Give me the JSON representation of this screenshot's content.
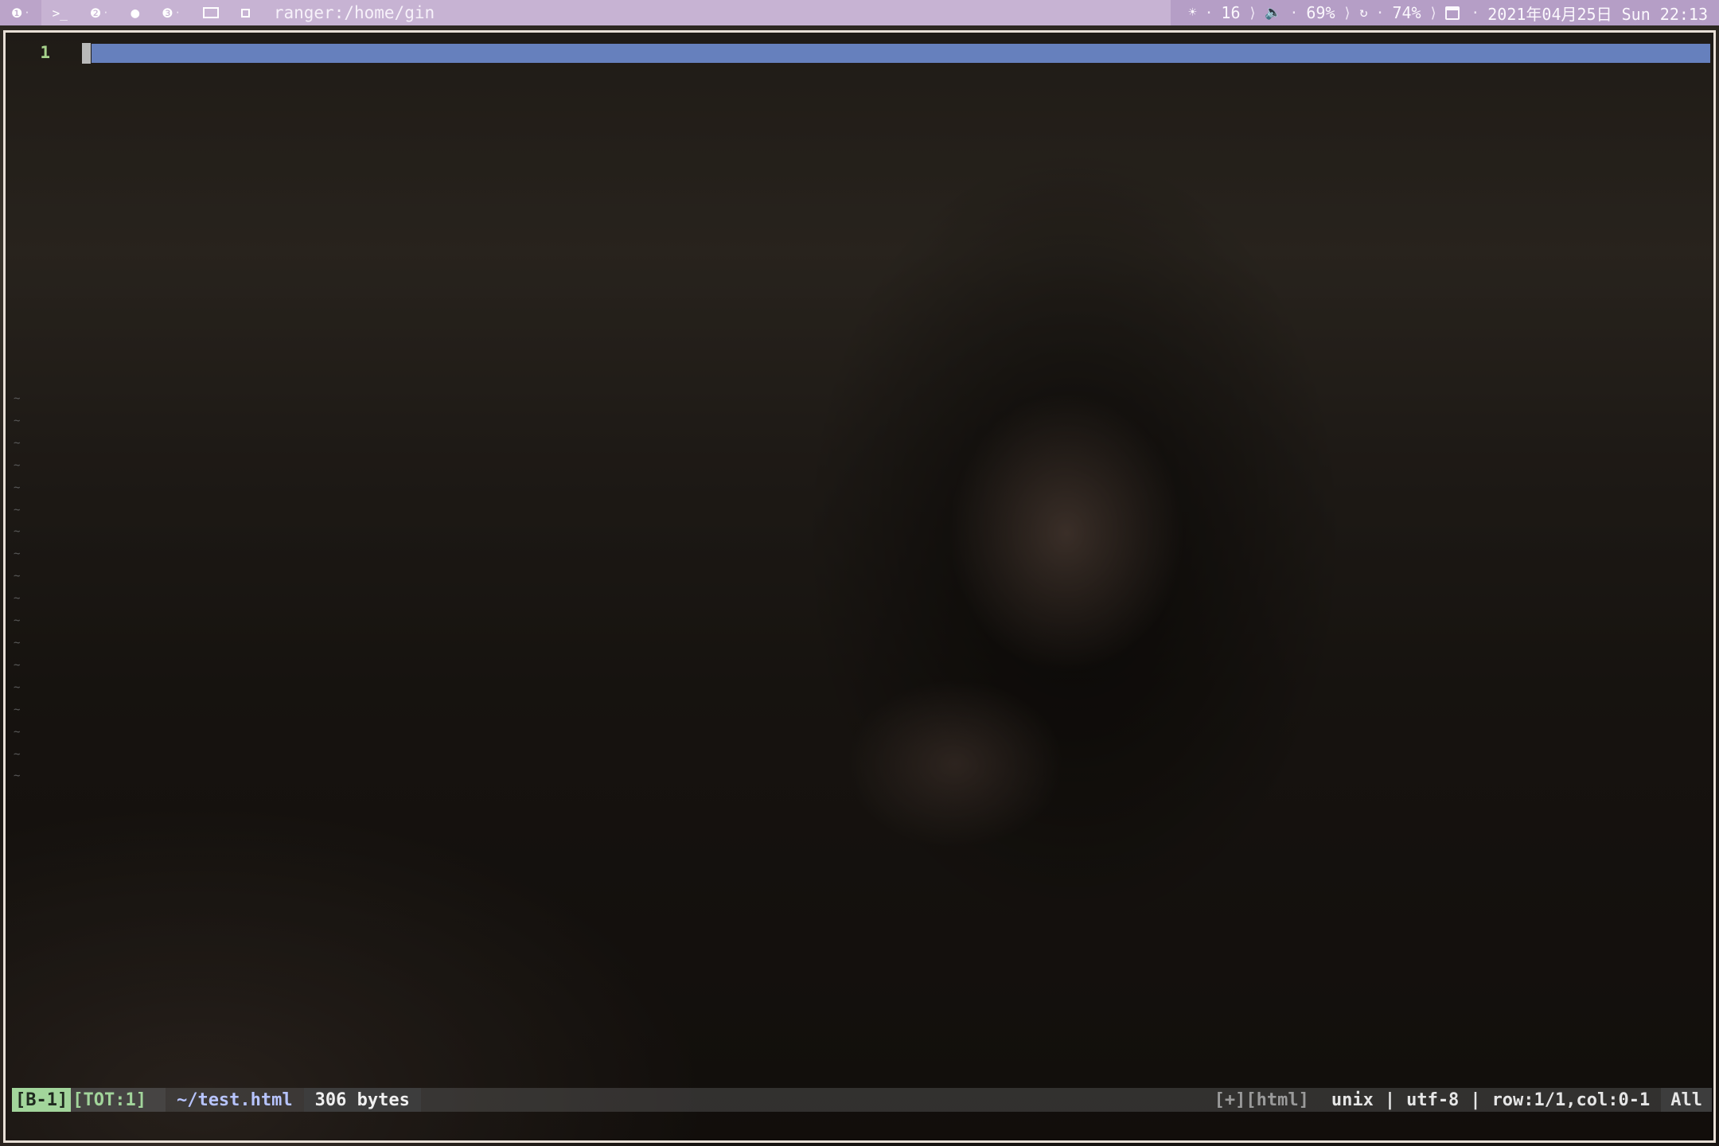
{
  "topbar": {
    "workspaces": [
      {
        "icon": "1",
        "name": "workspace-1"
      },
      {
        "icon": ">_",
        "name": "terminal"
      },
      {
        "icon": "2",
        "name": "workspace-2"
      },
      {
        "icon": "●",
        "name": "browser"
      },
      {
        "icon": "3",
        "name": "workspace-3"
      },
      {
        "icon": "▭",
        "name": "monitor"
      },
      {
        "icon": "▫",
        "name": "layout"
      }
    ],
    "window_title": "ranger:/home/gin",
    "brightness_value": "16",
    "volume_value": "69%",
    "battery_value": "74%",
    "datetime": "2021年04月25日 Sun 22:13"
  },
  "editor": {
    "line_number": "1",
    "tilde": "~"
  },
  "statusline": {
    "buffer": "[B-1]",
    "total": "[TOT:1]",
    "filename": "~/test.html",
    "filesize": "306 bytes",
    "filetype": "[+][html]",
    "format": "unix",
    "encoding": "utf-8",
    "position": "row:1/1,col:0-1",
    "scroll": "All"
  },
  "colors": {
    "topbar_bg": "#c7b3d3",
    "cursorline": "#6680bd",
    "line_number": "#a7d28c",
    "buffer_badge": "#a2d59b",
    "filename": "#b7c4ff"
  }
}
